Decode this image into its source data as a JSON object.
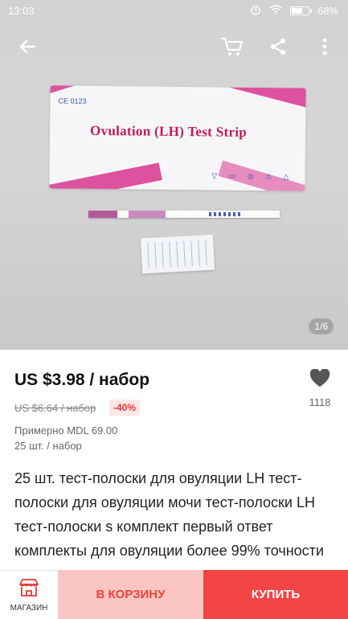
{
  "status": {
    "time": "13:03",
    "battery": "68%",
    "battery_fraction": 0.68
  },
  "gallery": {
    "package_title": "Ovulation (LH) Test Strip",
    "ce_mark": "CE 0123",
    "counter": "1/6"
  },
  "product": {
    "price": "US $3.98 / набор",
    "old_price": "US $6.64 / набор",
    "discount": "-40%",
    "wishlist_count": "1118",
    "approx_price": "Примерно MDL 69.00",
    "unit": "25 шт. / набор",
    "title": "25 шт. тест-полоски для овуляции LH тест-полоски для овуляции мочи тест-полоски LH тест-полоски s комплект первый ответ комплекты для овуляции более 99% точности"
  },
  "bottom": {
    "shop_label": "МАГАЗИН",
    "cart_label": "В КОРЗИНУ",
    "buy_label": "КУПИТЬ"
  },
  "colors": {
    "accent": "#f44545",
    "cart_bg": "#fbc6c1",
    "discount": "#e53935"
  }
}
